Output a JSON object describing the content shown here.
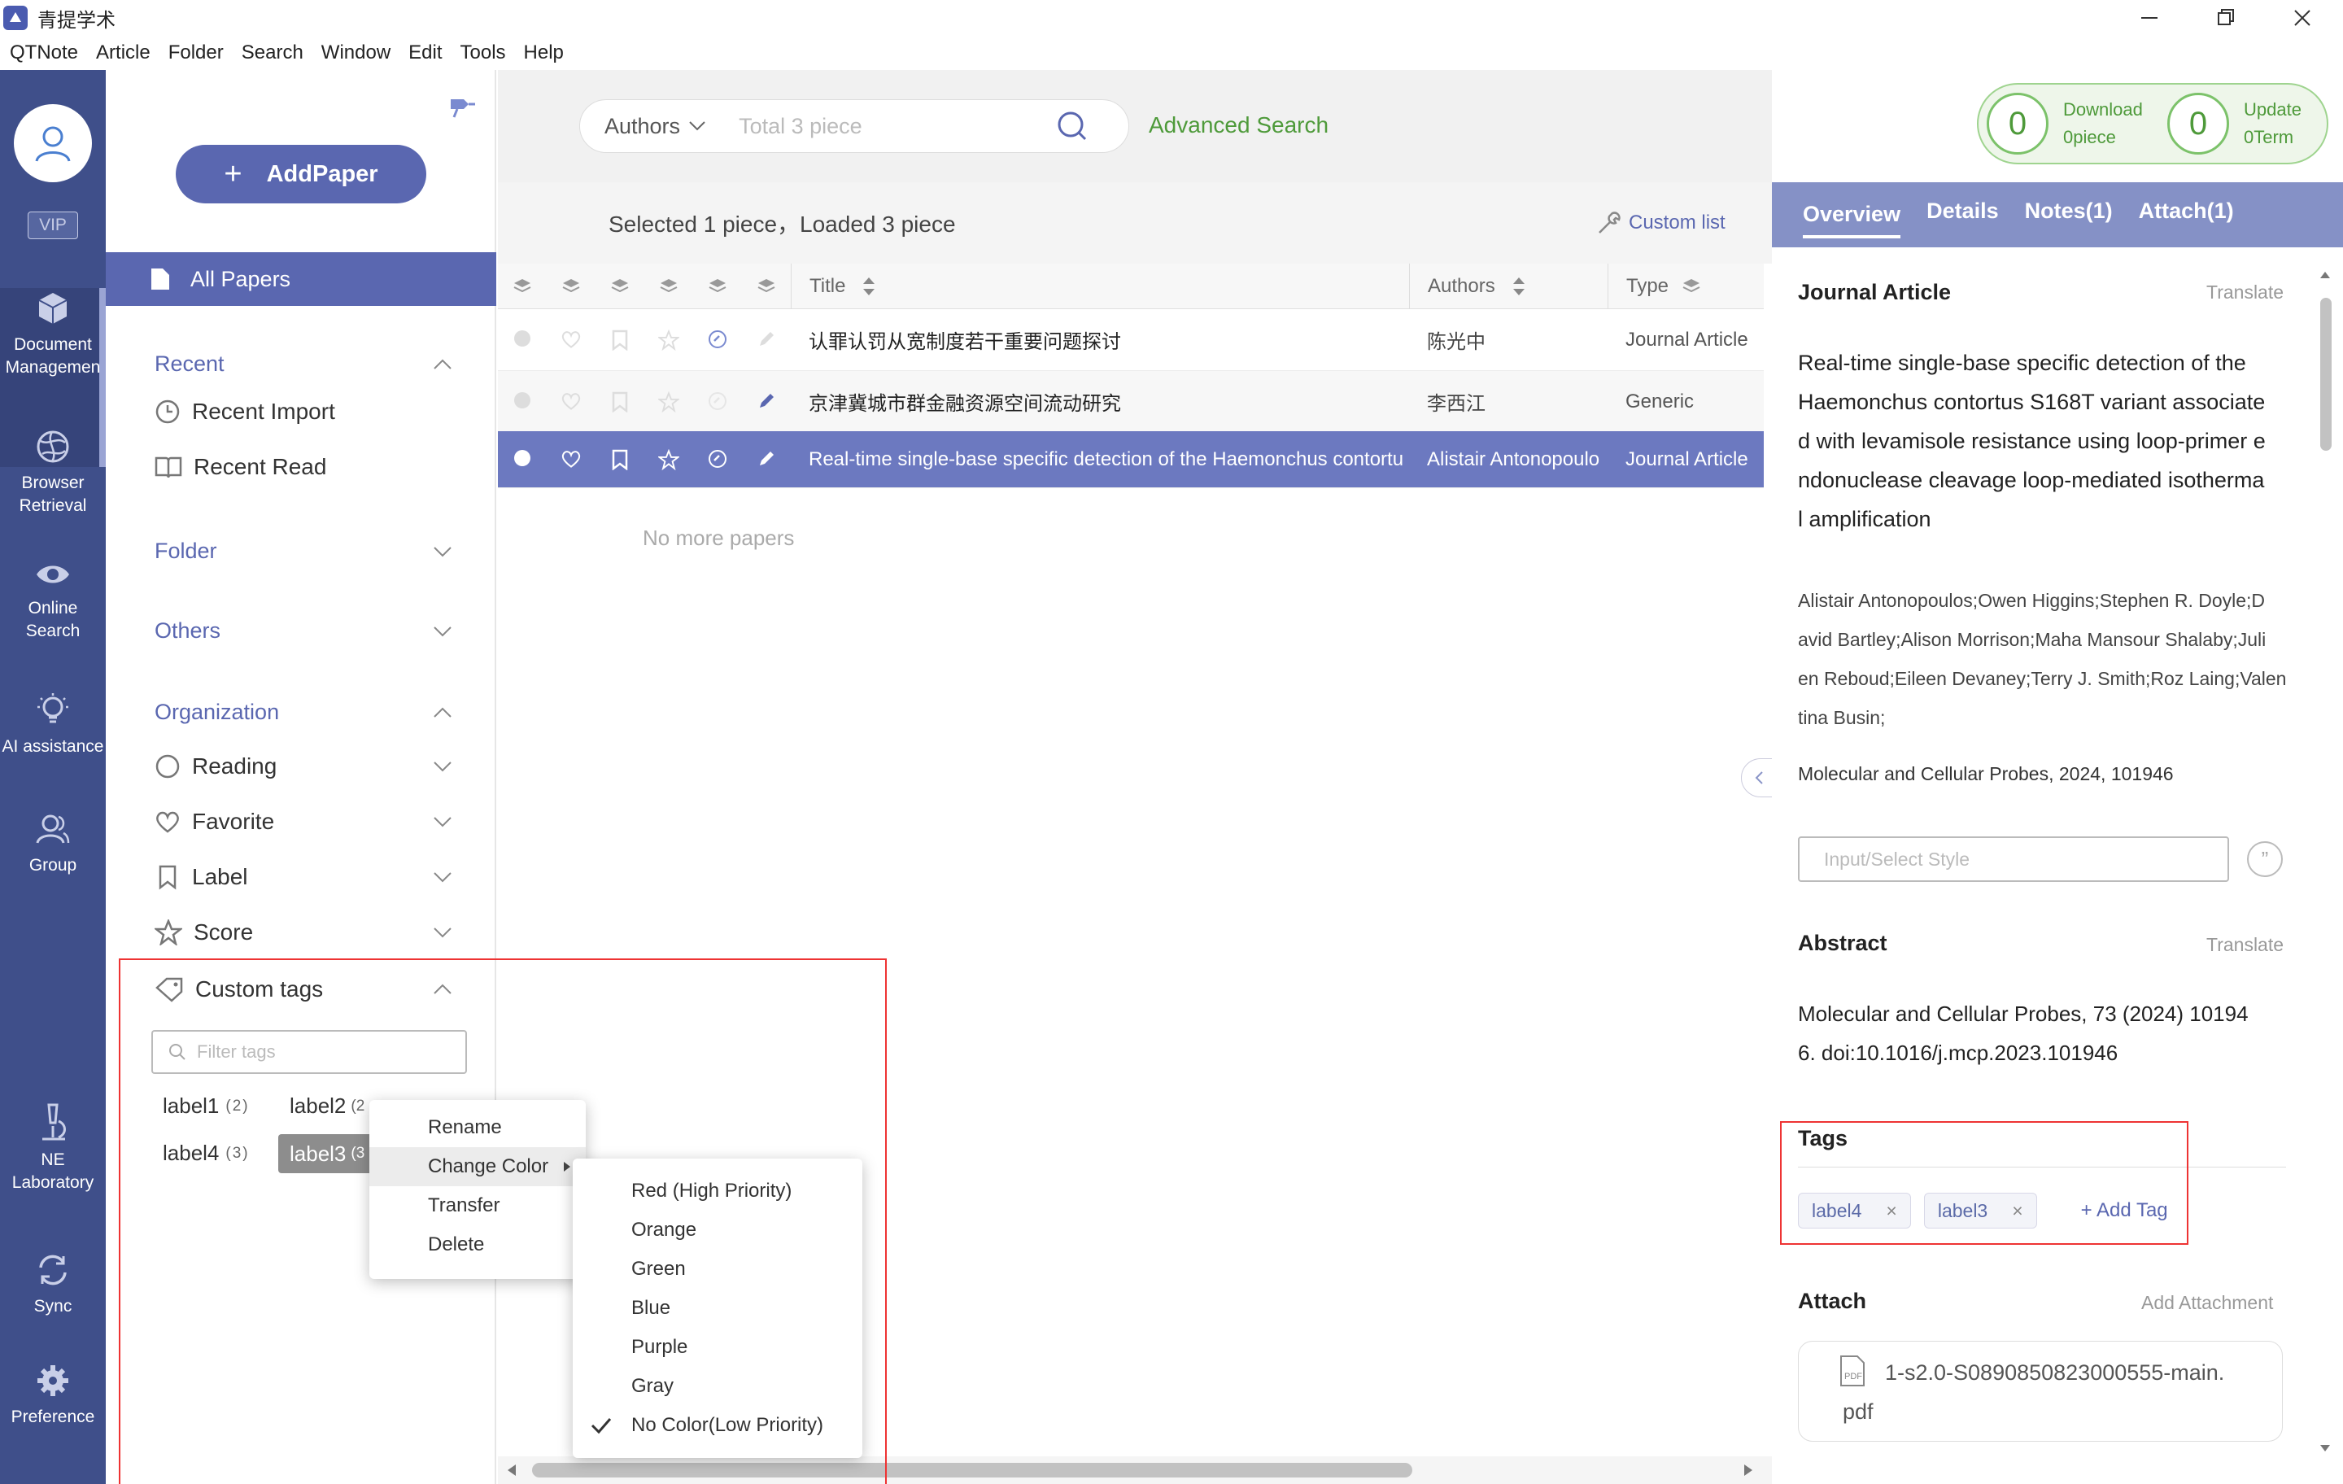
{
  "window": {
    "title": "青提学术"
  },
  "menubar": [
    "QTNote",
    "Article",
    "Folder",
    "Search",
    "Window",
    "Edit",
    "Tools",
    "Help"
  ],
  "rail": {
    "vip": "VIP",
    "items": [
      {
        "label1": "Document",
        "label2": "Managemen",
        "icon": "cube-icon"
      },
      {
        "label1": "Browser",
        "label2": "Retrieval",
        "icon": "globe-icon"
      },
      {
        "label1": "Online",
        "label2": "Search",
        "icon": "eye-icon"
      },
      {
        "label1": "AI assistance",
        "label2": "",
        "icon": "ai-bulb-icon"
      },
      {
        "label1": "Group",
        "label2": "",
        "icon": "group-icon"
      },
      {
        "label1": "NE",
        "label2": "Laboratory",
        "icon": "microscope-icon"
      },
      {
        "label1": "Sync",
        "label2": "",
        "icon": "sync-icon"
      },
      {
        "label1": "Preference",
        "label2": "",
        "icon": "gear-icon"
      }
    ]
  },
  "sidebar": {
    "add_paper": "AddPaper",
    "all_papers": "All Papers",
    "recent": "Recent",
    "recent_import": "Recent Import",
    "recent_read": "Recent Read",
    "folder": "Folder",
    "others": "Others",
    "organization": "Organization",
    "reading": "Reading",
    "favorite": "Favorite",
    "label": "Label",
    "score": "Score",
    "custom_tags": "Custom tags",
    "filter_placeholder": "Filter tags",
    "tags": [
      {
        "name": "label1",
        "count": "(2)"
      },
      {
        "name": "label2",
        "count": "(2"
      },
      {
        "name": "label4",
        "count": "(3)"
      },
      {
        "name": "label3",
        "count": "(3"
      }
    ]
  },
  "context_menu": {
    "items": [
      "Rename",
      "Change Color",
      "Transfer",
      "Delete"
    ]
  },
  "color_menu": {
    "items": [
      "Red (High Priority)",
      "Orange",
      "Green",
      "Blue",
      "Purple",
      "Gray",
      "No Color(Low Priority)"
    ],
    "checked": "No Color(Low Priority)"
  },
  "search": {
    "field": "Authors",
    "placeholder": "Total 3 piece",
    "advanced": "Advanced Search"
  },
  "counters": [
    {
      "value": "0",
      "label": "Download",
      "sub": "0piece"
    },
    {
      "value": "0",
      "label": "Update",
      "sub": "0Term"
    }
  ],
  "list": {
    "status": "Selected 1 piece，Loaded 3 piece",
    "custom_list": "Custom list",
    "columns": {
      "title": "Title",
      "authors": "Authors",
      "type": "Type"
    },
    "rows": [
      {
        "title": "认罪认罚从宽制度若干重要问题探讨",
        "author": "陈光中",
        "type": "Journal Article"
      },
      {
        "title": "京津冀城市群金融资源空间流动研究",
        "author": "李西江",
        "type": "Generic"
      },
      {
        "title": "Real-time single-base specific detection of the Haemonchus contortu",
        "author": "Alistair Antonopoulo",
        "type": "Journal Article"
      }
    ],
    "no_more": "No more papers"
  },
  "detail": {
    "tabs": [
      "Overview",
      "Details",
      "Notes(1)",
      "Attach(1)"
    ],
    "type": "Journal Article",
    "translate": "Translate",
    "title_lines": [
      "Real-time single-base specific detection of the",
      "Haemonchus contortus S168T variant associate",
      "d with levamisole resistance using loop-primer e",
      "ndonuclease cleavage loop-mediated isotherma",
      "l amplification"
    ],
    "author_lines": [
      "Alistair Antonopoulos;Owen Higgins;Stephen R. Doyle;D",
      "avid Bartley;Alison Morrison;Maha Mansour Shalaby;Juli",
      "en Reboud;Eileen Devaney;Terry J. Smith;Roz Laing;Valen",
      "tina Busin;"
    ],
    "journal": "Molecular and Cellular Probes, 2024, 101946",
    "style_placeholder": "Input/Select Style",
    "abstract_title": "Abstract",
    "abstract_lines": [
      "Molecular and Cellular Probes, 73 (2024) 10194",
      "6. doi:10.1016/j.mcp.2023.101946"
    ],
    "tags_title": "Tags",
    "tags": [
      "label4",
      "label3"
    ],
    "add_tag": "+ Add Tag",
    "attach_title": "Attach",
    "add_attachment": "Add Attachment",
    "attachment_lines": [
      "1-s2.0-S0890850823000555-main.",
      "pdf"
    ]
  },
  "colors": {
    "rail": "#3f4f8a",
    "accent": "#5a67b0",
    "selected_row": "#6c79c0",
    "green": "#5aa84a",
    "red_box": "#e33333"
  }
}
